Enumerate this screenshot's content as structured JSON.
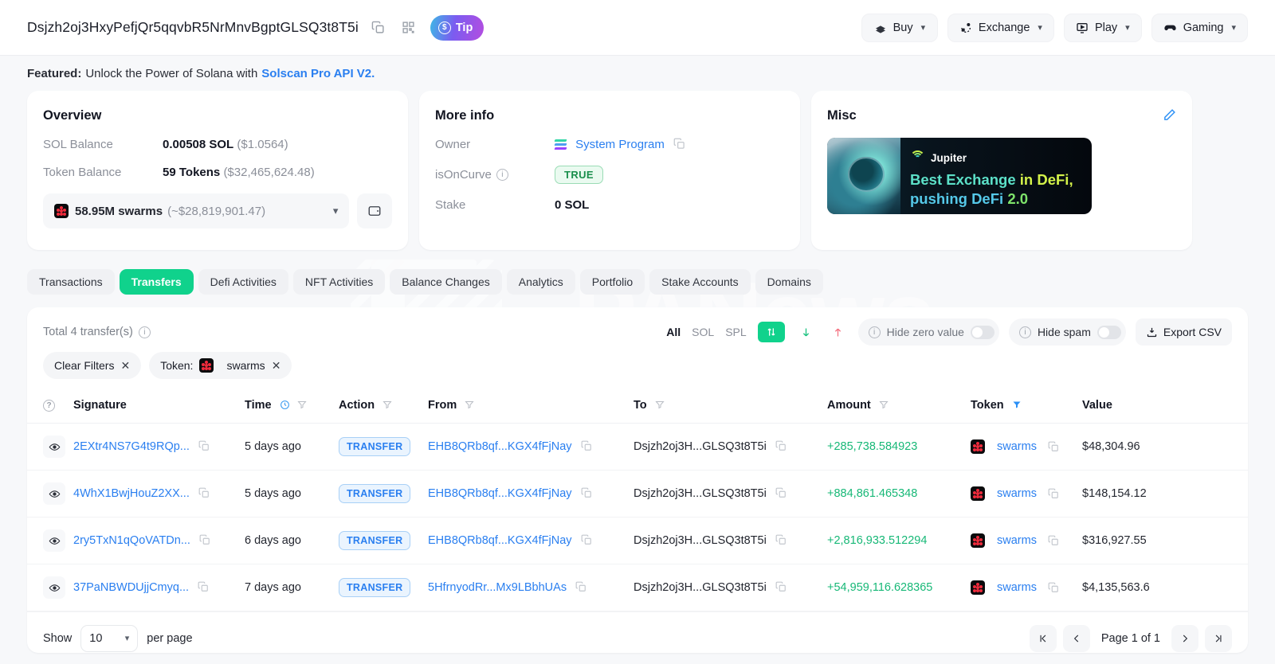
{
  "header": {
    "address": "Dsjzh2oj3HxyPefjQr5qqvbR5NrMnvBgptGLSQ3t8T5i",
    "copy_icon": "copy-icon",
    "qr_icon": "qr-code-icon",
    "tip_label": "Tip",
    "actions": [
      {
        "label": "Buy",
        "icon": "buy-icon"
      },
      {
        "label": "Exchange",
        "icon": "exchange-icon"
      },
      {
        "label": "Play",
        "icon": "play-icon"
      },
      {
        "label": "Gaming",
        "icon": "gaming-icon"
      }
    ]
  },
  "featured": {
    "prefix": "Featured:",
    "text": "Unlock the Power of Solana with",
    "link": "Solscan Pro API V2."
  },
  "overview": {
    "title": "Overview",
    "sol_balance_label": "SOL Balance",
    "sol_balance_value": "0.00508 SOL",
    "sol_balance_usd": "($1.0564)",
    "token_balance_label": "Token Balance",
    "token_balance_value": "59 Tokens",
    "token_balance_usd": "($32,465,624.48)",
    "token_select_amount": "58.95M swarms",
    "token_select_usd": "(~$28,819,901.47)",
    "wallet_icon": "wallet-icon"
  },
  "more_info": {
    "title": "More info",
    "owner_label": "Owner",
    "owner_value": "System Program",
    "is_on_curve_label": "isOnCurve",
    "is_on_curve_value": "TRUE",
    "stake_label": "Stake",
    "stake_value": "0 SOL"
  },
  "misc": {
    "title": "Misc",
    "edit_icon": "pencil-edit-icon",
    "banner": {
      "brand": "Jupiter",
      "line1_a": "Best Exchange",
      "line1_b": "in DeFi,",
      "line2_a": "pushing DeFi",
      "line2_b": "2.0"
    }
  },
  "watermark": {
    "text": "PANews"
  },
  "tabs": [
    {
      "label": "Transactions",
      "active": false
    },
    {
      "label": "Transfers",
      "active": true
    },
    {
      "label": "Defi Activities",
      "active": false
    },
    {
      "label": "NFT Activities",
      "active": false
    },
    {
      "label": "Balance Changes",
      "active": false
    },
    {
      "label": "Analytics",
      "active": false
    },
    {
      "label": "Portfolio",
      "active": false
    },
    {
      "label": "Stake Accounts",
      "active": false
    },
    {
      "label": "Domains",
      "active": false
    }
  ],
  "toolbar": {
    "total_text": "Total 4 transfer(s)",
    "segments": [
      "All",
      "SOL",
      "SPL"
    ],
    "segment_selected": "All",
    "sort_icon": "sort-up-down-icon",
    "in_icon": "arrow-down-icon",
    "out_icon": "arrow-up-icon",
    "hide_zero_label": "Hide zero value",
    "hide_spam_label": "Hide spam",
    "export_label": "Export CSV",
    "export_icon": "download-icon"
  },
  "filters": [
    {
      "label": "Clear Filters",
      "has_token_icon": false
    },
    {
      "label": "Token:",
      "value": "swarms",
      "has_token_icon": true
    }
  ],
  "table": {
    "columns": [
      {
        "label": "",
        "icon": "help-circle-icon"
      },
      {
        "label": "Signature"
      },
      {
        "label": "Time",
        "icon": "clock-icon",
        "filter": true
      },
      {
        "label": "Action",
        "filter": true
      },
      {
        "label": "From",
        "filter": true
      },
      {
        "label": "To",
        "filter": true
      },
      {
        "label": "Amount",
        "filter": true
      },
      {
        "label": "Token",
        "filter": true,
        "filter_active": true
      },
      {
        "label": "Value"
      }
    ],
    "rows": [
      {
        "signature": "2EXtr4NS7G4t9RQp...",
        "time": "5 days ago",
        "action": "TRANSFER",
        "from": "EHB8QRb8qf...KGX4fFjNay",
        "to": "Dsjzh2oj3H...GLSQ3t8T5i",
        "amount": "+285,738.584923",
        "token": "swarms",
        "value": "$48,304.96"
      },
      {
        "signature": "4WhX1BwjHouZ2XX...",
        "time": "5 days ago",
        "action": "TRANSFER",
        "from": "EHB8QRb8qf...KGX4fFjNay",
        "to": "Dsjzh2oj3H...GLSQ3t8T5i",
        "amount": "+884,861.465348",
        "token": "swarms",
        "value": "$148,154.12"
      },
      {
        "signature": "2ry5TxN1qQoVATDn...",
        "time": "6 days ago",
        "action": "TRANSFER",
        "from": "EHB8QRb8qf...KGX4fFjNay",
        "to": "Dsjzh2oj3H...GLSQ3t8T5i",
        "amount": "+2,816,933.512294",
        "token": "swarms",
        "value": "$316,927.55"
      },
      {
        "signature": "37PaNBWDUjjCmyq...",
        "time": "7 days ago",
        "action": "TRANSFER",
        "from": "5HfrnyodRr...Mx9LBbhUAs",
        "to": "Dsjzh2oj3H...GLSQ3t8T5i",
        "amount": "+54,959,116.628365",
        "token": "swarms",
        "value": "$4,135,563.6"
      }
    ]
  },
  "footer": {
    "show_label": "Show",
    "per_page_value": "10",
    "per_page_label": "per page",
    "page_label": "Page 1 of 1",
    "first_icon": "chevron-first-icon",
    "prev_icon": "chevron-left-icon",
    "next_icon": "chevron-right-icon",
    "last_icon": "chevron-last-icon"
  },
  "colors": {
    "accent_green": "#10d28c",
    "link_blue": "#2a7ff0",
    "amount_green": "#17b877",
    "bg": "#f7f8fa"
  }
}
